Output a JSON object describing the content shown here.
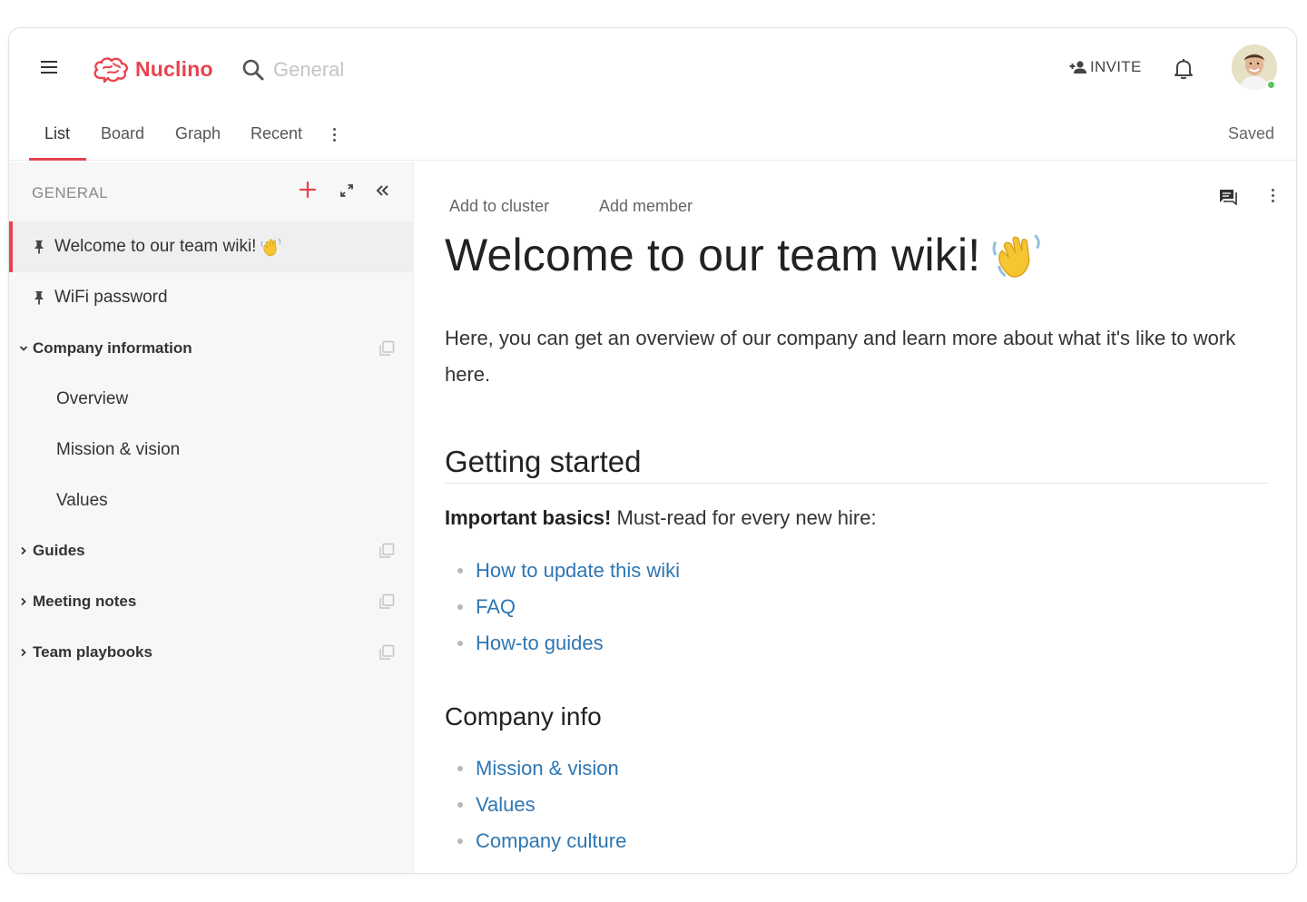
{
  "app": {
    "name": "Nuclino",
    "brand_color": "#e8434e",
    "link_color": "#2e76b3"
  },
  "header": {
    "search_placeholder": "General",
    "invite_label": "INVITE"
  },
  "tabs": {
    "items": [
      {
        "label": "List",
        "active": true
      },
      {
        "label": "Board",
        "active": false
      },
      {
        "label": "Graph",
        "active": false
      },
      {
        "label": "Recent",
        "active": false
      }
    ],
    "status": "Saved"
  },
  "sidebar": {
    "header": "GENERAL",
    "items": [
      {
        "label": "Welcome to our team wiki!",
        "pinned": true,
        "selected": true
      },
      {
        "label": "WiFi password",
        "pinned": true
      },
      {
        "label": "Company information",
        "group": true,
        "expanded": true
      },
      {
        "label": "Overview",
        "child": true
      },
      {
        "label": "Mission & vision",
        "child": true
      },
      {
        "label": "Values",
        "child": true
      },
      {
        "label": "Guides",
        "group": true,
        "expanded": false
      },
      {
        "label": "Meeting notes",
        "group": true,
        "expanded": false
      },
      {
        "label": "Team playbooks",
        "group": true,
        "expanded": false
      }
    ]
  },
  "document": {
    "actions": [
      "Add to cluster",
      "Add member"
    ],
    "title": "Welcome to our team wiki!",
    "intro": "Here, you can get an overview of our company and learn more about what it's like to work here.",
    "section1": {
      "heading": "Getting started",
      "lead_bold": "Important basics!",
      "lead_rest": " Must-read for every new hire:",
      "links": [
        "How to update this wiki",
        "FAQ",
        "How-to guides"
      ]
    },
    "section2": {
      "heading": "Company info",
      "links": [
        "Mission & vision",
        "Values",
        "Company culture"
      ]
    }
  }
}
